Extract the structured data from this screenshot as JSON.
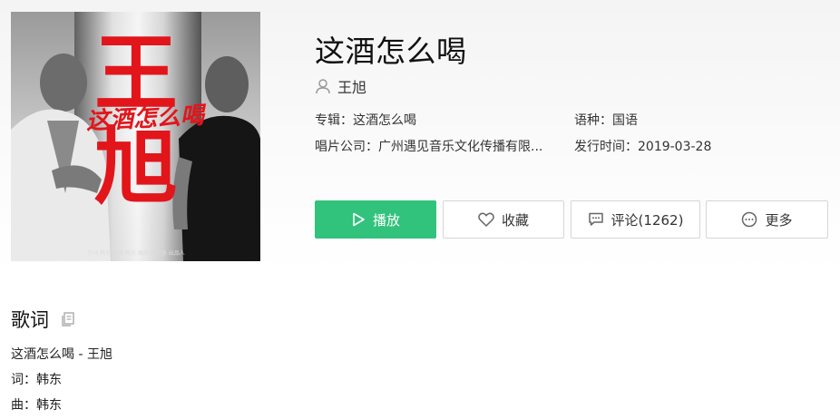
{
  "song": {
    "title": "这酒怎么喝",
    "artist": "王旭"
  },
  "cover": {
    "big_text_top": "王",
    "big_text_bottom": "旭",
    "script_text": "这酒怎么喝",
    "credits": "作词 韩东  作曲 韩东  编曲 赵文强  出品人"
  },
  "meta": {
    "album_label": "专辑：",
    "album_value": "这酒怎么喝",
    "language_label": "语种：",
    "language_value": "国语",
    "company_label": "唱片公司：",
    "company_value": "广州遇见音乐文化传播有限...",
    "release_label": "发行时间：",
    "release_value": "2019-03-28"
  },
  "actions": {
    "play": "播放",
    "favorite": "收藏",
    "comment": "评论(1262)",
    "more": "更多"
  },
  "lyrics": {
    "title": "歌词",
    "lines": [
      "这酒怎么喝 - 王旭",
      "词：韩东",
      "曲：韩东"
    ]
  },
  "colors": {
    "accent_green": "#31c27c",
    "cover_red": "#e2151b"
  },
  "icons": [
    "user-icon",
    "play-icon",
    "heart-icon",
    "comment-icon",
    "more-icon",
    "copy-icon"
  ]
}
